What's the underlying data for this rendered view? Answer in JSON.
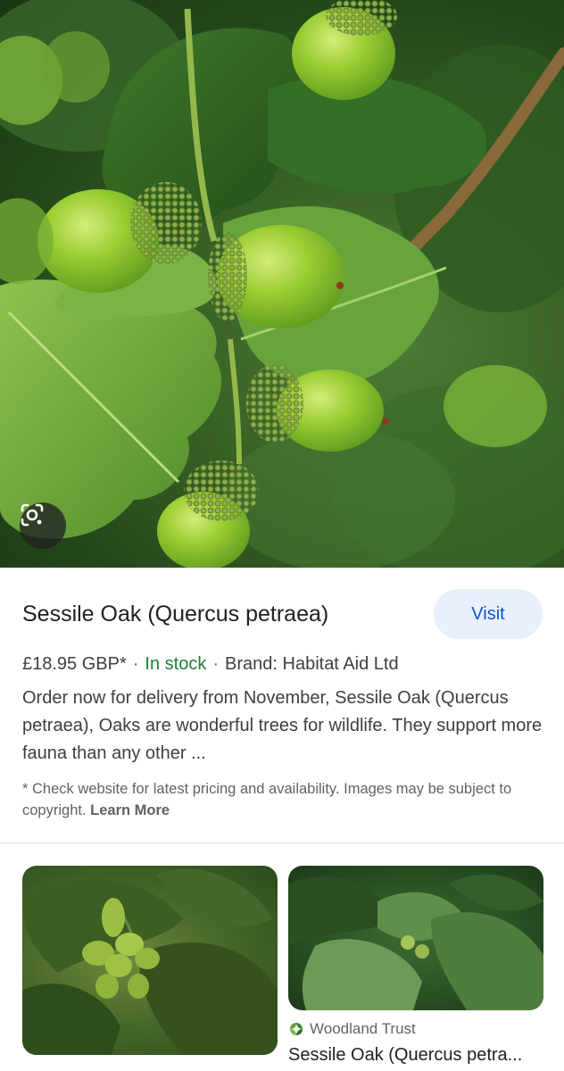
{
  "product": {
    "title": "Sessile Oak (Quercus petraea)",
    "visit_label": "Visit",
    "price": "£18.95 GBP*",
    "separator": "·",
    "stock": "In stock",
    "brand": "Brand: Habitat Aid Ltd",
    "description": "Order now for delivery from November, Sessile Oak (Quercus petraea), Oaks are wonderful trees for wildlife. They support more fauna than any other ...",
    "note": "* Check website for latest pricing and availability. Images may be subject to copyright.",
    "learn_more": "Learn More"
  },
  "hero": {
    "icon": "google-lens-icon"
  },
  "related": [
    {
      "image_icon": "acorn-photo"
    },
    {
      "source": "Woodland Trust",
      "source_icon": "woodland-trust-logo-icon",
      "title": "Sessile Oak (Quercus petra..."
    }
  ],
  "colors": {
    "accent": "#0b57d0",
    "visit_bg": "#e8f0fe",
    "stock": "#188038",
    "text": "#202124",
    "secondary": "#5f6368"
  }
}
